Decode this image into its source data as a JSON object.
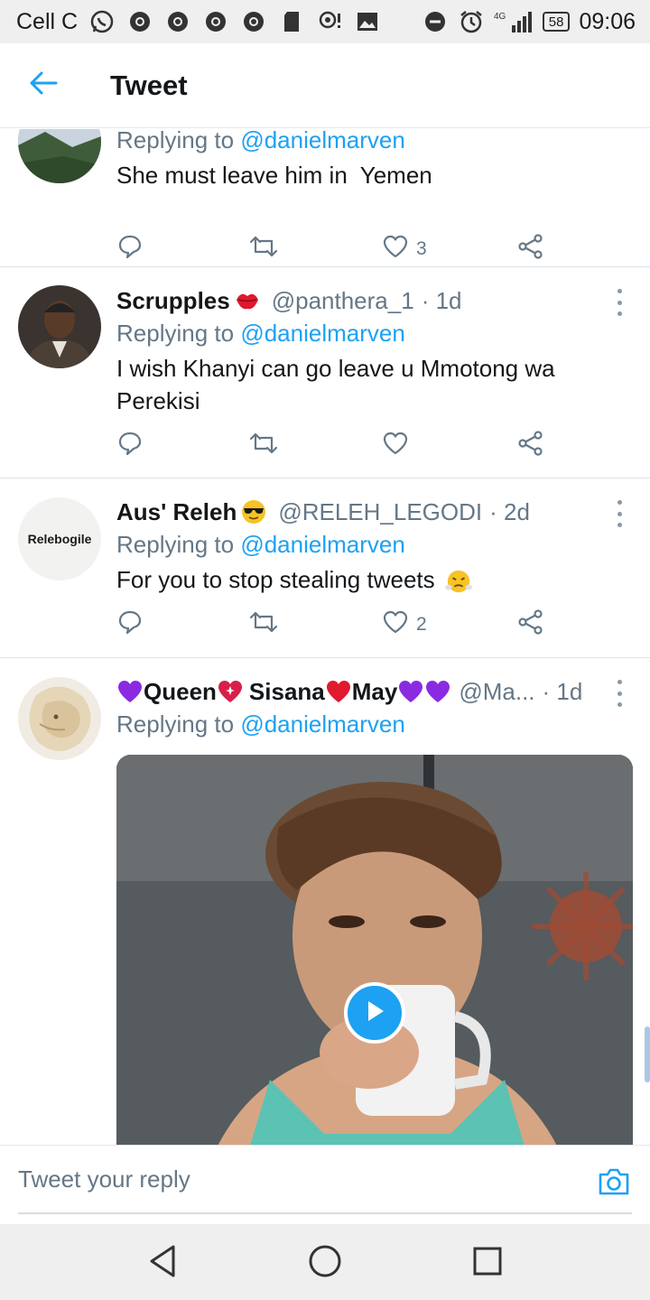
{
  "status_bar": {
    "carrier": "Cell C",
    "network": "4G",
    "battery": "58",
    "time": "09:06",
    "icons": [
      "whatsapp-icon",
      "chrome-icon",
      "chrome-icon",
      "chrome-icon",
      "chrome-icon",
      "sd-card-icon",
      "location-icon",
      "gallery-icon",
      "dnd-icon",
      "alarm-icon",
      "signal-icon",
      "battery-icon"
    ]
  },
  "header": {
    "title": "Tweet",
    "back_icon": "arrow-left-icon"
  },
  "tweets": [
    {
      "name": "",
      "handle": "",
      "time": "",
      "replying_prefix": "Replying to",
      "replying_to": "@danielmarven",
      "text": "She must leave him in  Yemen",
      "reply_count": "",
      "retweet_count": "",
      "like_count": "3"
    },
    {
      "name": "Scrupples",
      "name_emoji": "lips",
      "handle": "@panthera_1",
      "time": "· 1d",
      "replying_prefix": "Replying to",
      "replying_to": "@danielmarven",
      "text": "I wish Khanyi can go leave u Mmotong wa Perekisi",
      "like_count": ""
    },
    {
      "name": "Aus' Releh",
      "name_emoji": "sunglasses",
      "handle": "@RELEH_LEGODI",
      "time": "· 2d",
      "avatar_label": "Relebogile",
      "replying_prefix": "Replying to",
      "replying_to": "@danielmarven",
      "text": "For you to stop stealing tweets",
      "text_emoji": "triumph",
      "like_count": "2"
    },
    {
      "name_part1": "Queen",
      "name_part2": "Sisana",
      "name_part3": "May",
      "handle": "@Ma...",
      "time": "· 1d",
      "replying_prefix": "Replying to",
      "replying_to": "@danielmarven",
      "media": "gif-video"
    }
  ],
  "composer": {
    "placeholder": "Tweet your reply",
    "camera_icon": "camera-icon"
  },
  "nav_bar": {
    "buttons": [
      "back-triangle-icon",
      "home-circle-icon",
      "recents-square-icon"
    ]
  },
  "colors": {
    "accent": "#1da1f2",
    "text_primary": "#14171a",
    "text_secondary": "#657786",
    "divider": "#dde3e8"
  }
}
